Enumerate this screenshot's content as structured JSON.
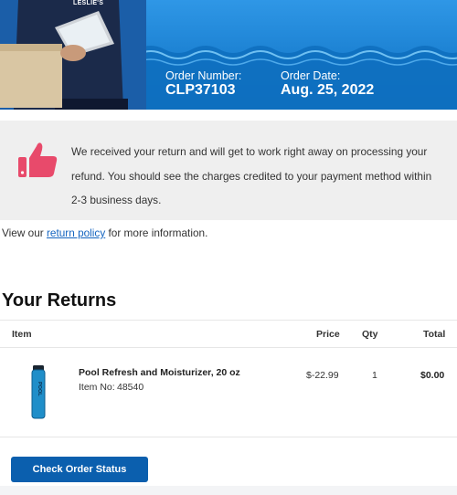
{
  "brand": {
    "logo_text": "LESLIE'S"
  },
  "order": {
    "number_label": "Order Number:",
    "number_value": "CLP37103",
    "date_label": "Order Date:",
    "date_value": "Aug. 25, 2022"
  },
  "message": {
    "icon": "thumbs-up-icon",
    "text": "We received your return and will get to work right away on processing your refund. You should see the charges credited to your payment method within 2-3 business days."
  },
  "policy": {
    "prefix": "View our ",
    "link": "return policy",
    "suffix": " for more information."
  },
  "returns": {
    "title": "Your Returns",
    "columns": {
      "item": "Item",
      "price": "Price",
      "qty": "Qty",
      "total": "Total"
    },
    "items": [
      {
        "name": "Pool Refresh and Moisturizer, 20 oz",
        "item_no_label": "Item No:",
        "item_no": "48540",
        "price": "$-22.99",
        "qty": "1",
        "total": "$0.00",
        "image_text": "POOL"
      }
    ]
  },
  "actions": {
    "check_status": "Check Order Status"
  },
  "colors": {
    "brand_blue": "#0b76c8",
    "button_blue": "#0b5fae",
    "accent_pink": "#e84a6b",
    "link": "#1565c0"
  }
}
